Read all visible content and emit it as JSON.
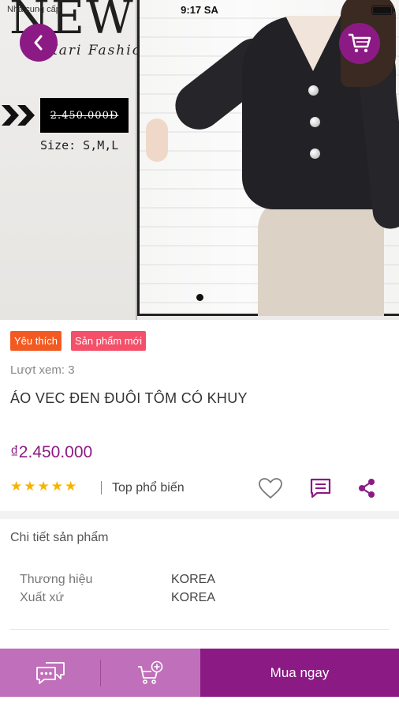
{
  "status_bar": {
    "carrier": "Nhà cung cấp",
    "time": "9:17 SA",
    "battery_level": 1.0
  },
  "hero": {
    "brand_title": "NEW",
    "brand_script": "Kari Fashion",
    "price_tag": "2.450.000Đ",
    "size_text": "Size: S,M,L",
    "carousel_page": 1,
    "carousel_total": 1
  },
  "nav": {
    "back_icon": "chevron-left-icon",
    "cart_icon": "cart-icon",
    "accent_color": "#8c1a84"
  },
  "product": {
    "badges": [
      {
        "label": "Yêu thích",
        "color": "#f25a22"
      },
      {
        "label": "Sản phẩm mới",
        "color": "#f4506a"
      }
    ],
    "views": "Lượt xem: 3",
    "title": "ÁO VEC ĐEN ĐUÔI TÔM CÓ KHUY",
    "price": "₫2.450.000",
    "rating": 5,
    "stars_text": "★★★★★",
    "popularity": "Top phổ biến",
    "actions": [
      "heart-icon",
      "comment-icon",
      "share-icon"
    ]
  },
  "details": {
    "heading": "Chi tiết sản phẩm",
    "specs": [
      {
        "key": "Thương hiệu",
        "value": "KOREA"
      },
      {
        "key": "Xuất xứ",
        "value": "KOREA"
      }
    ]
  },
  "bottom_bar": {
    "chat_icon": "chat-bubbles-icon",
    "add_cart_icon": "cart-plus-icon",
    "buy_label": "Mua ngay"
  }
}
